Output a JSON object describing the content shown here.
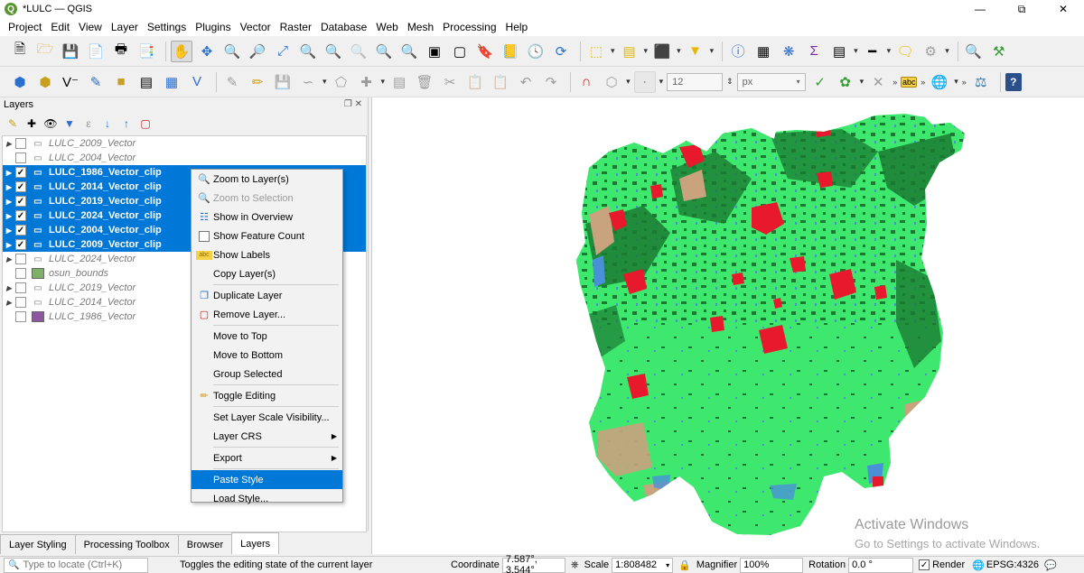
{
  "window": {
    "title": "*LULC — QGIS",
    "logo": "Q"
  },
  "menu": [
    "Project",
    "Edit",
    "View",
    "Layer",
    "Settings",
    "Plugins",
    "Vector",
    "Raster",
    "Database",
    "Web",
    "Mesh",
    "Processing",
    "Help"
  ],
  "toolbar2": {
    "font_size_value": "12",
    "unit_value": "px"
  },
  "layers_panel": {
    "title": "Layers",
    "layers": [
      {
        "name": "LULC_2009_Vector",
        "selected": false,
        "checked": false,
        "expandable": true,
        "icon": "polygon-layer-icon"
      },
      {
        "name": "LULC_2004_Vector",
        "selected": false,
        "checked": false,
        "expandable": false,
        "icon": "polygon-layer-icon"
      },
      {
        "name": "LULC_1986_Vector_clip",
        "selected": true,
        "checked": true,
        "expandable": true,
        "icon": "polygon-layer-icon"
      },
      {
        "name": "LULC_2014_Vector_clip",
        "selected": true,
        "checked": true,
        "expandable": true,
        "icon": "polygon-layer-icon"
      },
      {
        "name": "LULC_2019_Vector_clip",
        "selected": true,
        "checked": true,
        "expandable": true,
        "icon": "polygon-layer-icon"
      },
      {
        "name": "LULC_2024_Vector_clip",
        "selected": true,
        "checked": true,
        "expandable": true,
        "icon": "polygon-layer-icon"
      },
      {
        "name": "LULC_2004_Vector_clip",
        "selected": true,
        "checked": true,
        "expandable": true,
        "icon": "polygon-layer-icon"
      },
      {
        "name": "LULC_2009_Vector_clip",
        "selected": true,
        "checked": true,
        "expandable": true,
        "icon": "polygon-layer-icon"
      },
      {
        "name": "LULC_2024_Vector",
        "selected": false,
        "checked": false,
        "expandable": true,
        "icon": "polygon-layer-icon"
      },
      {
        "name": "osun_bounds",
        "selected": false,
        "checked": false,
        "expandable": false,
        "swatch": "#7fb06a"
      },
      {
        "name": "LULC_2019_Vector",
        "selected": false,
        "checked": false,
        "expandable": true,
        "icon": "polygon-layer-icon"
      },
      {
        "name": "LULC_2014_Vector",
        "selected": false,
        "checked": false,
        "expandable": true,
        "icon": "polygon-layer-icon"
      },
      {
        "name": "LULC_1986_Vector",
        "selected": false,
        "checked": false,
        "expandable": false,
        "swatch": "#8e58a0"
      }
    ]
  },
  "context_menu": [
    {
      "label": "Zoom to Layer(s)",
      "icon": "zoom-layer-icon",
      "disabled": false
    },
    {
      "label": "Zoom to Selection",
      "icon": "zoom-selection-icon",
      "disabled": true
    },
    {
      "label": "Show in Overview",
      "icon": "overview-icon",
      "disabled": false
    },
    {
      "label": "Show Feature Count",
      "icon": "checkbox",
      "disabled": false
    },
    {
      "label": "Show Labels",
      "icon": "labels-icon",
      "disabled": false
    },
    {
      "label": "Copy Layer(s)",
      "icon": "",
      "disabled": false,
      "sep_after": true
    },
    {
      "label": "Duplicate Layer",
      "icon": "duplicate-icon",
      "disabled": false
    },
    {
      "label": "Remove Layer...",
      "icon": "remove-layer-icon",
      "disabled": false,
      "sep_after": true
    },
    {
      "label": "Move to Top",
      "icon": "",
      "disabled": false
    },
    {
      "label": "Move to Bottom",
      "icon": "",
      "disabled": false
    },
    {
      "label": "Group Selected",
      "icon": "",
      "disabled": false,
      "sep_after": true
    },
    {
      "label": "Toggle Editing",
      "icon": "pencil-icon",
      "disabled": false,
      "sep_after": true
    },
    {
      "label": "Set Layer Scale Visibility...",
      "icon": "",
      "disabled": false
    },
    {
      "label": "Layer CRS",
      "icon": "",
      "disabled": false,
      "submenu": true,
      "sep_after": true
    },
    {
      "label": "Export",
      "icon": "",
      "disabled": false,
      "submenu": true,
      "sep_after": true
    },
    {
      "label": "Paste Style",
      "icon": "",
      "disabled": false,
      "highlighted": true
    },
    {
      "label": "Load Style...",
      "icon": "",
      "disabled": false
    }
  ],
  "dock_tabs": [
    "Layer Styling",
    "Processing Toolbox",
    "Browser",
    "Layers"
  ],
  "dock_active": "Layers",
  "watermark": {
    "line1": "Activate Windows",
    "line2": "Go to Settings to activate Windows."
  },
  "statusbar": {
    "locator_placeholder": "Type to locate (Ctrl+K)",
    "message": "Toggles the editing state of the current layer",
    "coordinate_label": "Coordinate",
    "coordinate_value": "7.587°, 3.544°",
    "scale_label": "Scale",
    "scale_value": "1:808482",
    "magnifier_label": "Magnifier",
    "magnifier_value": "100%",
    "rotation_label": "Rotation",
    "rotation_value": "0.0 °",
    "render_label": "Render",
    "crs_label": "EPSG:4326"
  },
  "colors": {
    "selection": "#0078d7",
    "lulc_grassland": "#3ee86e",
    "lulc_forest": "#1a7a32",
    "lulc_builtup": "#e8192c",
    "lulc_bare": "#c9a27e",
    "lulc_water": "#4a90d9"
  }
}
